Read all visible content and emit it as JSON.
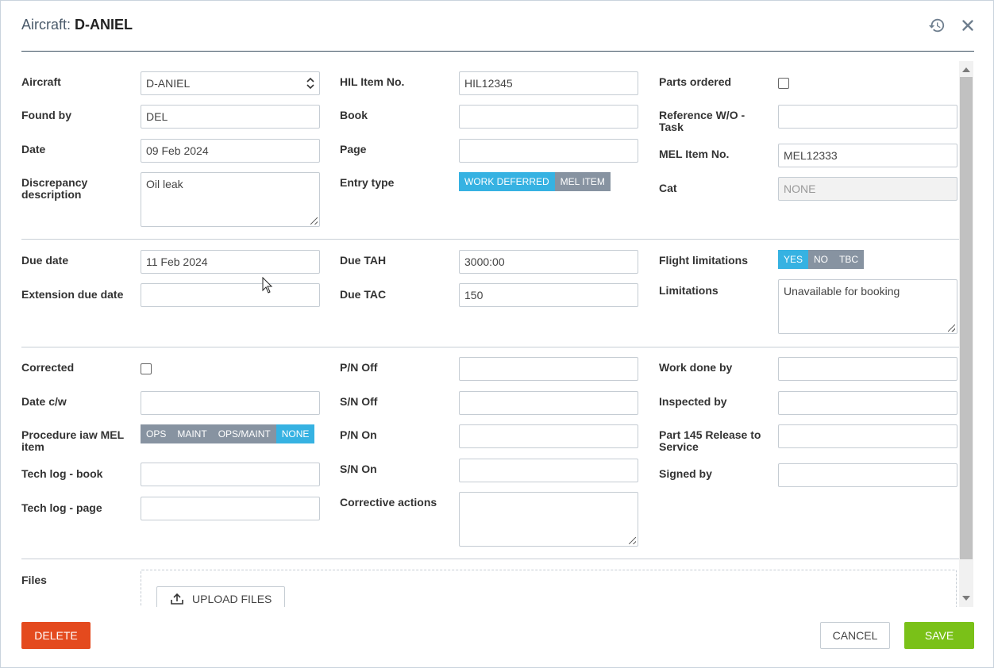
{
  "header": {
    "title_prefix": "Aircraft:",
    "title_value": "D-ANIEL"
  },
  "section1": {
    "aircraft": {
      "label": "Aircraft",
      "value": "D-ANIEL"
    },
    "found_by": {
      "label": "Found by",
      "value": "DEL"
    },
    "date": {
      "label": "Date",
      "value": "09 Feb 2024"
    },
    "discrepancy": {
      "label": "Discrepancy description",
      "value": "Oil leak"
    },
    "hil_item": {
      "label": "HIL Item No.",
      "value": "HIL12345"
    },
    "book": {
      "label": "Book",
      "value": ""
    },
    "page": {
      "label": "Page",
      "value": ""
    },
    "entry_type": {
      "label": "Entry type",
      "options": [
        "WORK DEFERRED",
        "MEL ITEM"
      ],
      "selected": "WORK DEFERRED"
    },
    "parts_ordered": {
      "label": "Parts ordered",
      "checked": false
    },
    "reference_wo": {
      "label": "Reference W/O - Task",
      "value": ""
    },
    "mel_item": {
      "label": "MEL Item No.",
      "value": "MEL12333"
    },
    "cat": {
      "label": "Cat",
      "value": "NONE"
    }
  },
  "section2": {
    "due_date": {
      "label": "Due date",
      "value": "11 Feb 2024"
    },
    "extension_due_date": {
      "label": "Extension due date",
      "value": ""
    },
    "due_tah": {
      "label": "Due TAH",
      "value": "3000:00"
    },
    "due_tac": {
      "label": "Due TAC",
      "value": "150"
    },
    "flight_limitations": {
      "label": "Flight limitations",
      "options": [
        "YES",
        "NO",
        "TBC"
      ],
      "selected": "YES"
    },
    "limitations": {
      "label": "Limitations",
      "value": "Unavailable for booking"
    }
  },
  "section3": {
    "corrected": {
      "label": "Corrected",
      "checked": false
    },
    "date_cw": {
      "label": "Date c/w",
      "value": ""
    },
    "procedure": {
      "label": "Procedure iaw MEL item",
      "options": [
        "OPS",
        "MAINT",
        "OPS/MAINT",
        "NONE"
      ],
      "selected": "NONE"
    },
    "tech_log_book": {
      "label": "Tech log - book",
      "value": ""
    },
    "tech_log_page": {
      "label": "Tech log - page",
      "value": ""
    },
    "pn_off": {
      "label": "P/N Off",
      "value": ""
    },
    "sn_off": {
      "label": "S/N Off",
      "value": ""
    },
    "pn_on": {
      "label": "P/N On",
      "value": ""
    },
    "sn_on": {
      "label": "S/N On",
      "value": ""
    },
    "corrective_actions": {
      "label": "Corrective actions",
      "value": ""
    },
    "work_done_by": {
      "label": "Work done by",
      "value": ""
    },
    "inspected_by": {
      "label": "Inspected by",
      "value": ""
    },
    "part145": {
      "label": "Part 145 Release to Service",
      "value": ""
    },
    "signed_by": {
      "label": "Signed by",
      "value": ""
    }
  },
  "files": {
    "label": "Files",
    "upload_label": "UPLOAD FILES"
  },
  "footer": {
    "delete_label": "DELETE",
    "cancel_label": "CANCEL",
    "save_label": "SAVE"
  },
  "colors": {
    "active_segment": "#36b2e2",
    "inactive_segment": "#8793a1",
    "delete": "#e44a1e",
    "save": "#7ac118"
  }
}
